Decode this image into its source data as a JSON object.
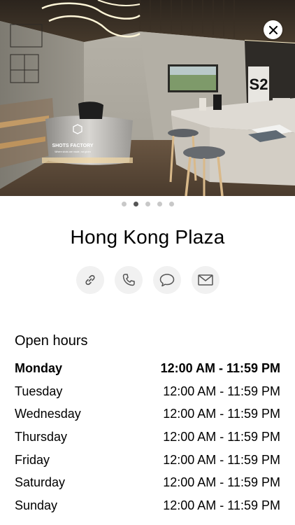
{
  "hero": {
    "image": "showroom photo",
    "reception_sign": "SHOTS FACTORY",
    "reception_tagline": "Where shots are made, not given",
    "wall_badge": "S2",
    "carousel": {
      "count": 5,
      "active": 2
    }
  },
  "store": {
    "name": "Hong Kong Plaza"
  },
  "actions": [
    {
      "name": "link",
      "icon": "link-icon"
    },
    {
      "name": "phone",
      "icon": "phone-icon"
    },
    {
      "name": "message",
      "icon": "message-bubble-icon"
    },
    {
      "name": "email",
      "icon": "envelope-icon"
    }
  ],
  "hours": {
    "title": "Open hours",
    "days": [
      {
        "day": "Monday",
        "time": "12:00 AM - 11:59 PM",
        "current": true
      },
      {
        "day": "Tuesday",
        "time": "12:00 AM - 11:59 PM"
      },
      {
        "day": "Wednesday",
        "time": "12:00 AM - 11:59 PM"
      },
      {
        "day": "Thursday",
        "time": "12:00 AM - 11:59 PM"
      },
      {
        "day": "Friday",
        "time": "12:00 AM - 11:59 PM"
      },
      {
        "day": "Saturday",
        "time": "12:00 AM - 11:59 PM"
      },
      {
        "day": "Sunday",
        "time": "12:00 AM - 11:59 PM"
      }
    ]
  },
  "colors": {
    "action_bg": "#f1f1f1",
    "dot_active": "#555555",
    "dot_inactive": "#c8c8c8"
  }
}
